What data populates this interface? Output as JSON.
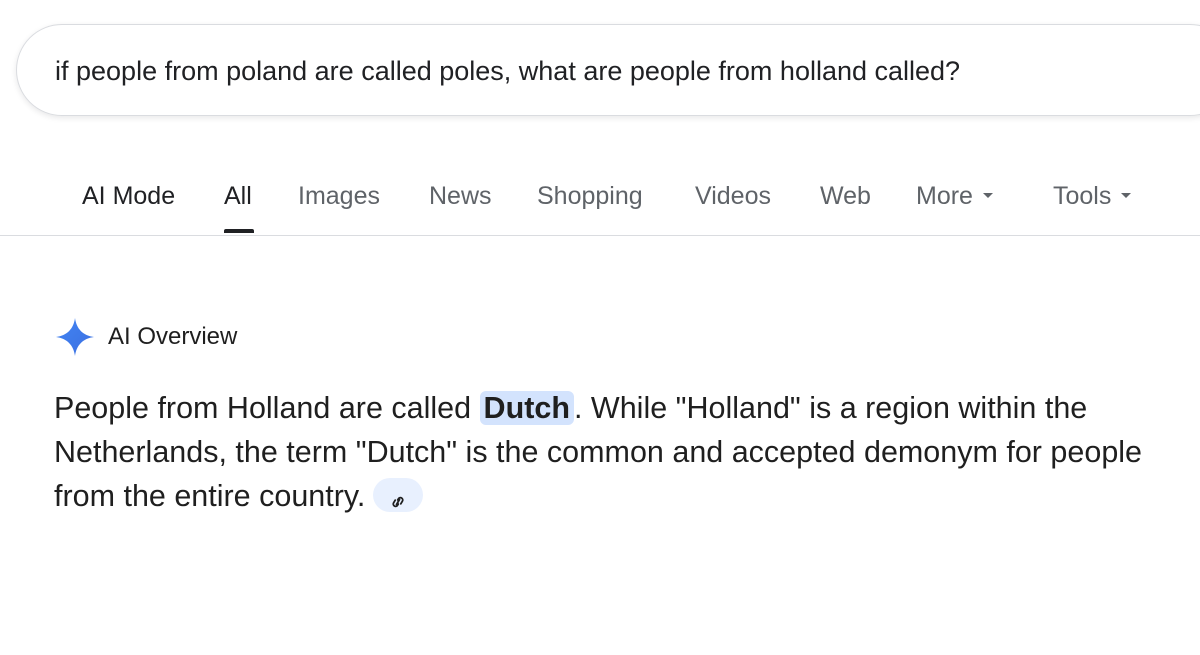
{
  "search": {
    "query": "if people from poland are called poles, what are people from holland called?"
  },
  "tabs": [
    {
      "label": "AI Mode"
    },
    {
      "label": "All"
    },
    {
      "label": "Images"
    },
    {
      "label": "News"
    },
    {
      "label": "Shopping"
    },
    {
      "label": "Videos"
    },
    {
      "label": "Web"
    },
    {
      "label": "More"
    },
    {
      "label": "Tools"
    }
  ],
  "active_tab": "All",
  "ai_overview": {
    "title": "AI Overview",
    "text_before": "People from Holland are called ",
    "highlight": "Dutch",
    "text_after": ". While \"Holland\" is a region within the Netherlands, the term \"Dutch\" is the common and accepted demonym for people from the entire country.",
    "link_icon": "link-icon"
  },
  "colors": {
    "accent": "#4285f4",
    "highlight_bg": "#d3e3fd",
    "chip_bg": "#e8f0fe",
    "text": "#1f1f1f",
    "muted": "#5f6368"
  }
}
